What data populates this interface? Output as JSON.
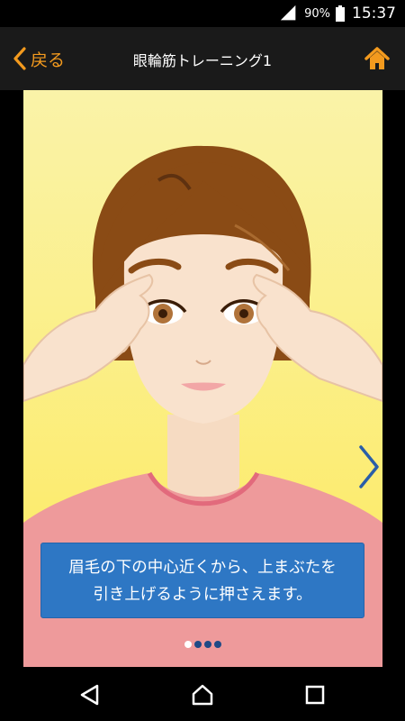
{
  "status_bar": {
    "battery_percent": "90%",
    "time": "15:37",
    "icons": [
      "wifi-icon",
      "battery-icon"
    ]
  },
  "app_bar": {
    "back_label": "戻る",
    "title": "眼輪筋トレーニング1",
    "back_icon": "chevron-left-icon",
    "home_icon": "home-icon",
    "accent_color": "#f39a1e"
  },
  "slide": {
    "caption_lines": [
      "眉毛の下の中心近くから、上まぶたを",
      "引き上げるように押さえます。"
    ],
    "next_icon": "chevron-right-icon",
    "pager": {
      "current": 1,
      "total": 4
    }
  },
  "nav_bar": {
    "icons": [
      "back-triangle-icon",
      "home-circle-icon",
      "recents-square-icon"
    ]
  }
}
